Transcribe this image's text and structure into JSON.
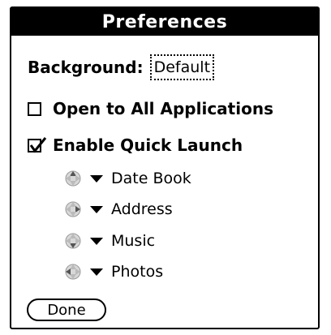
{
  "dialog": {
    "title": "Preferences",
    "background_label": "Background:",
    "background_value": "Default",
    "open_all_label": "Open to All Applications",
    "open_all_checked": false,
    "quick_launch_label": "Enable Quick Launch",
    "quick_launch_checked": true,
    "quick_launch_items": [
      {
        "icon": "dpad-up-icon",
        "label": "Date Book"
      },
      {
        "icon": "dpad-right-icon",
        "label": "Address"
      },
      {
        "icon": "dpad-down-icon",
        "label": "Music"
      },
      {
        "icon": "dpad-left-icon",
        "label": "Photos"
      }
    ],
    "done_label": "Done"
  }
}
